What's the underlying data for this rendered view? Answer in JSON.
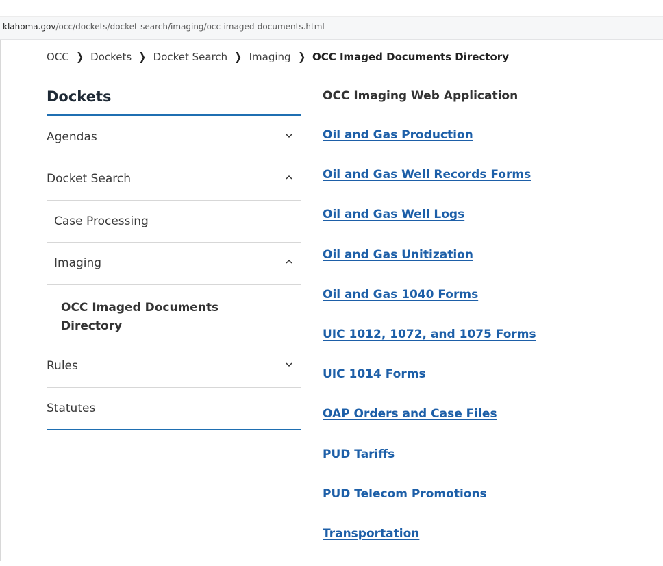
{
  "address_bar": {
    "host": "klahoma.gov",
    "path": "/occ/dockets/docket-search/imaging/occ-imaged-documents.html"
  },
  "breadcrumb": {
    "items": [
      "OCC",
      "Dockets",
      "Docket Search",
      "Imaging"
    ],
    "current": "OCC Imaged Documents Directory",
    "separator_icon": "chevron-right-icon"
  },
  "sidebar": {
    "title": "Dockets",
    "items": [
      {
        "label": "Agendas",
        "icon": "chevron-down-icon"
      },
      {
        "label": "Docket Search",
        "icon": "chevron-up-icon"
      },
      {
        "label": "Case Processing"
      },
      {
        "label": "Imaging",
        "icon": "chevron-up-icon"
      },
      {
        "label": "OCC Imaged Documents Directory"
      },
      {
        "label": "Rules",
        "icon": "chevron-down-icon"
      },
      {
        "label": "Statutes"
      }
    ]
  },
  "main": {
    "heading": "OCC Imaging Web Application",
    "links": [
      "Oil and Gas Production",
      "Oil and Gas Well Records Forms",
      "Oil and Gas Well Logs",
      "Oil and Gas Unitization",
      "Oil and Gas 1040 Forms",
      "UIC 1012, 1072, and 1075 Forms",
      "UIC 1014 Forms",
      "OAP Orders and Case Files",
      "PUD Tariffs",
      "PUD Telecom Promotions",
      "Transportation"
    ]
  },
  "colors": {
    "accent": "#1f6fb2",
    "link": "#1d5fa8"
  }
}
